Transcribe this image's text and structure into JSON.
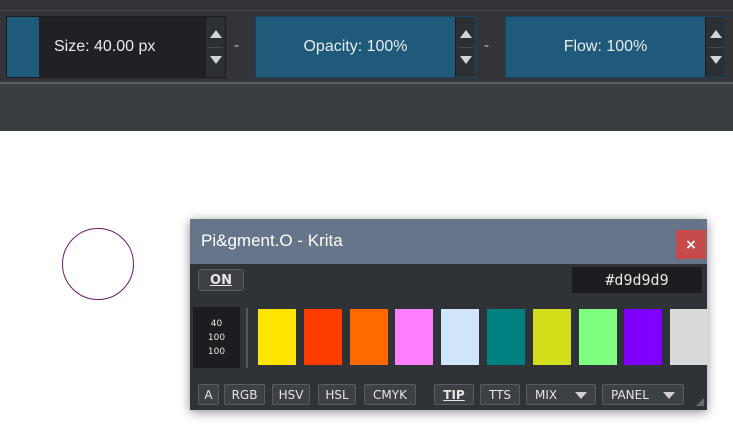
{
  "toolbar": {
    "size_label": "Size: 40.00 px",
    "opacity_label": "Opacity: 100%",
    "flow_label": "Flow: 100%",
    "separator": "-",
    "accent_color": "#1f5a7a"
  },
  "docker": {
    "title": "Pi&gment.O - Krita",
    "close_glyph": "×",
    "on_label": "ON",
    "hex_value": "#d9d9d9",
    "values": [
      "40",
      "100",
      "100"
    ],
    "swatches": [
      "#ffe500",
      "#ff3c00",
      "#ff6a00",
      "#ff80ff",
      "#d0e4fa",
      "#008080",
      "#d4de1a",
      "#80ff80",
      "#8000ff",
      "#d9d9d9"
    ],
    "buttons": {
      "a": "A",
      "rgb": "RGB",
      "hsv": "HSV",
      "hsl": "HSL",
      "cmyk": "CMYK",
      "tip": "TIP",
      "tts": "TTS",
      "mix": "MIX",
      "panel": "PANEL"
    }
  }
}
